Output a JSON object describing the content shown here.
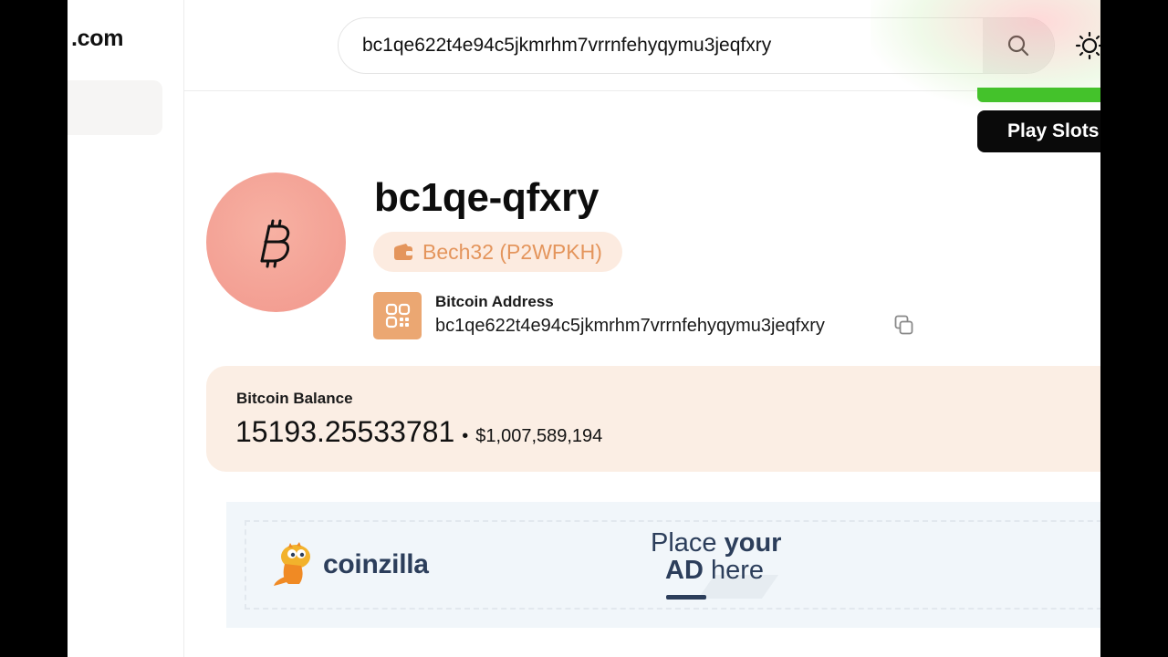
{
  "sidebar": {
    "logo": ".com"
  },
  "search": {
    "value": "bc1qe622t4e94c5jkmrhm7vrrnfehyqymu3jeqfxry"
  },
  "header": {
    "play_button": "Play Slots"
  },
  "address": {
    "short": "bc1qe-qfxry",
    "type": "Bech32 (P2WPKH)",
    "label": "Bitcoin Address",
    "full": "bc1qe622t4e94c5jkmrhm7vrrnfehyqymu3jeqfxry"
  },
  "balance": {
    "label": "Bitcoin Balance",
    "btc": "15193.25533781",
    "separator": "•",
    "usd": "$1,007,589,194"
  },
  "ad": {
    "brand": "coinzilla",
    "cta_word1": "Place ",
    "cta_word2": "your",
    "cta_word3": "AD",
    "cta_word4": " here"
  },
  "colors": {
    "accent": "#eba772",
    "avatar": "#f3a094",
    "balance_bg": "#fbeee4",
    "green": "#44c22b"
  },
  "icons": [
    "search-icon",
    "sun-icon",
    "bitcoin-icon",
    "wallet-icon",
    "qr-icon",
    "copy-icon",
    "coinzilla-mascot-icon"
  ]
}
